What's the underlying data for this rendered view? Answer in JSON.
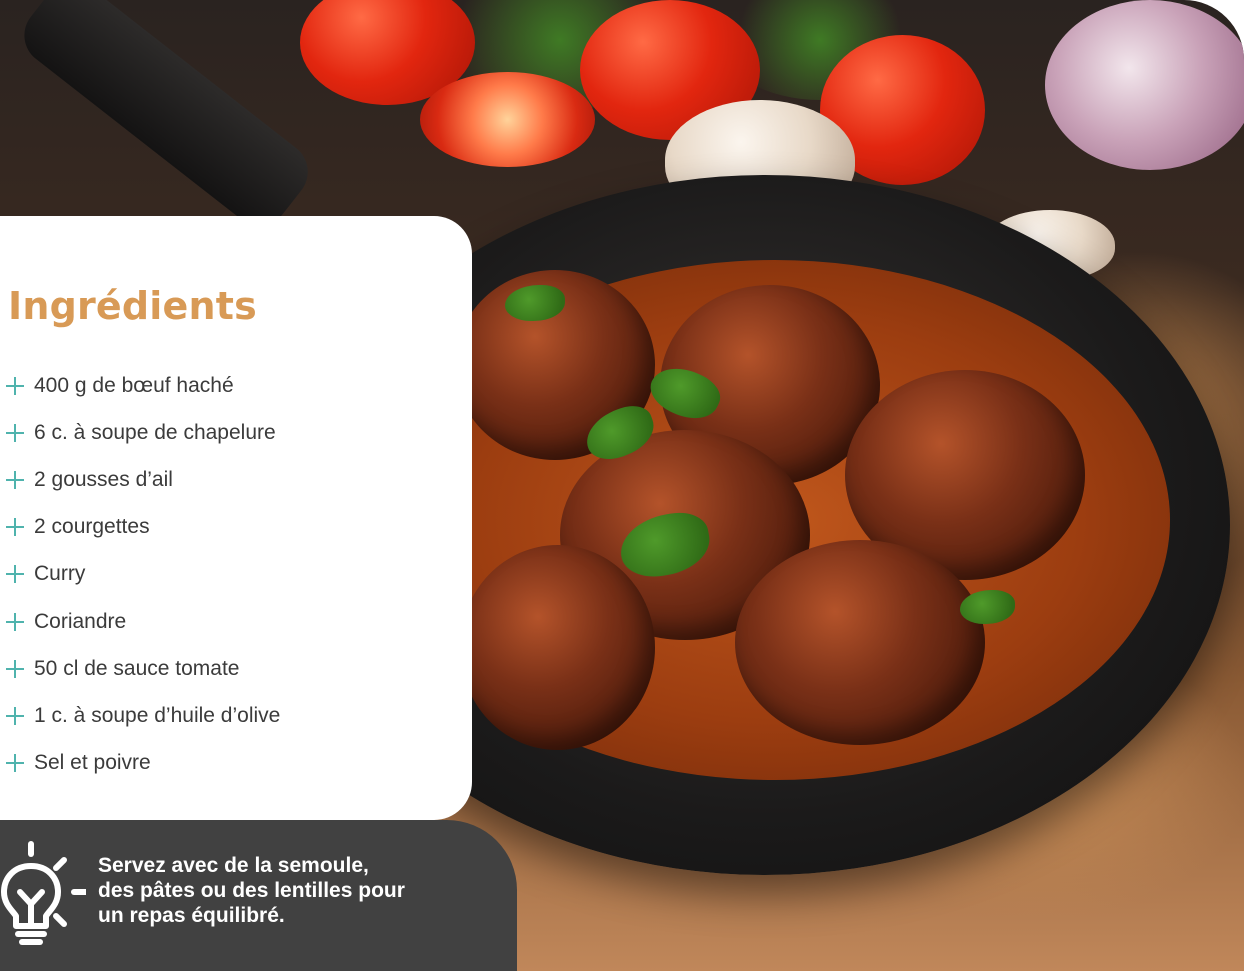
{
  "ingredients": {
    "title": "Ingrédients",
    "items": [
      "400 g de bœuf haché",
      "6 c. à soupe de chapelure",
      "2 gousses d’ail",
      "2 courgettes",
      "Curry",
      "Coriandre",
      "50 cl de sauce tomate",
      "1 c. à soupe d’huile d’olive",
      "Sel et poivre"
    ]
  },
  "tip": {
    "icon": "lightbulb-icon",
    "text": "Servez avec de la semoule,\ndes pâtes ou des lentilles pour\nun repas équilibré."
  },
  "colors": {
    "title": "#d89a56",
    "bullet": "#4fb3ad",
    "tip_background": "#414141",
    "text": "#3b3b3b"
  },
  "icons": {
    "bullet": "plus-icon",
    "photo": "meatballs-skillet-photo"
  }
}
